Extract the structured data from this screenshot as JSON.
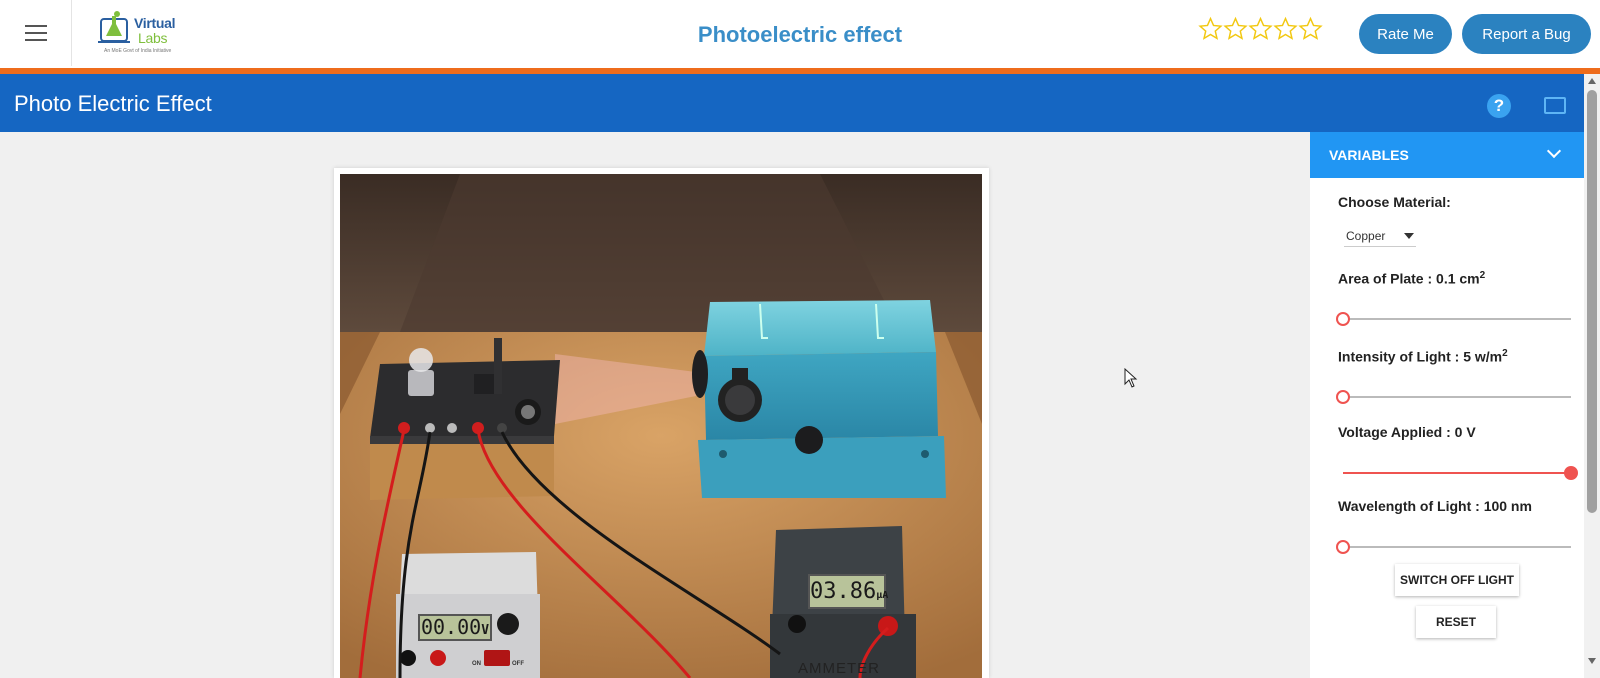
{
  "header": {
    "title": "Photoelectric effect",
    "logo": {
      "line1": "Virtual",
      "line2": "Labs",
      "tagline": "An MoE Govt of India Initiative"
    },
    "rating_stars": 5,
    "rating_value": 0,
    "rate_button": "Rate Me",
    "bug_button": "Report a Bug"
  },
  "simulation": {
    "title": "Photo Electric Effect",
    "help_icon": "question-circle-icon",
    "fullscreen_icon": "fullscreen-icon"
  },
  "scene": {
    "voltmeter_reading": "00.00",
    "voltmeter_unit": "V",
    "ammeter_reading": "03.86",
    "ammeter_unit": "μA",
    "ammeter_label": "AMMETER",
    "switch_on_label": "ON",
    "switch_off_label": "OFF"
  },
  "panel": {
    "header": "VARIABLES",
    "material_label": "Choose Material:",
    "material_selected": "Copper",
    "area_label": "Area of Plate : 0.1 cm",
    "area_sup": "2",
    "area_level": 0,
    "intensity_label": "Intensity of Light : 5 w/m",
    "intensity_sup": "2",
    "intensity_level": 0,
    "voltage_label": "Voltage Applied : 0 V",
    "voltage_level": 1,
    "wavelength_label": "Wavelength of Light : 100 nm",
    "wavelength_level": 0,
    "switch_light_button": "SWITCH OFF LIGHT",
    "reset_button": "RESET"
  },
  "colors": {
    "header_accent": "#ee6c1c",
    "title_bar": "#1566c2",
    "panel_header": "#2196f3",
    "header_buttons": "#2b82c0",
    "slider": "#ef5350",
    "star": "#f2c811"
  }
}
